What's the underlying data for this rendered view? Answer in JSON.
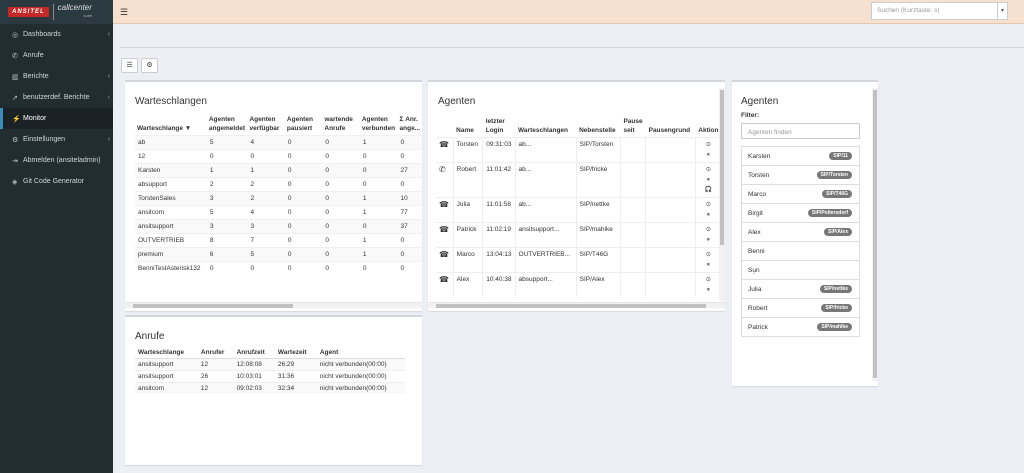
{
  "brand": {
    "logo_main": "ANSITEL",
    "logo_sub": "callcenter",
    "logo_suite": "suite"
  },
  "sidebar": {
    "items": [
      {
        "icon": "dashboard-icon",
        "glyph": "◎",
        "label": "Dashboards",
        "chevron": true
      },
      {
        "icon": "phone-icon",
        "glyph": "✆",
        "label": "Anrufe",
        "chevron": false
      },
      {
        "icon": "bar-chart-icon",
        "glyph": "▥",
        "label": "Berichte",
        "chevron": true
      },
      {
        "icon": "line-chart-icon",
        "glyph": "↗",
        "label": "benutzerdef. Berichte",
        "chevron": true
      },
      {
        "icon": "bolt-icon",
        "glyph": "⚡",
        "label": "Monitor",
        "chevron": false,
        "active": true
      },
      {
        "icon": "gears-icon",
        "glyph": "⚙",
        "label": "Einstellungen",
        "chevron": true
      },
      {
        "icon": "sign-out-icon",
        "glyph": "⇥",
        "label": "Abmelden (ansiteladmin)",
        "chevron": false
      },
      {
        "icon": "git-icon",
        "glyph": "◈",
        "label": "Git Code Generator",
        "chevron": false
      }
    ]
  },
  "header": {
    "search_placeholder": "Suchen (Kurztaste: s)"
  },
  "warteschlangen": {
    "title": "Warteschlangen",
    "columns": [
      "Warteschlange",
      "Agenten angemeldet",
      "Agenten verfügbar",
      "Agenten pausiert",
      "wartende Anrufe",
      "Agenten verbunden",
      "Σ Anr. ange..."
    ],
    "rows": [
      [
        "ab",
        "5",
        "4",
        "0",
        "0",
        "1",
        "0"
      ],
      [
        "12",
        "0",
        "0",
        "0",
        "0",
        "0",
        "0"
      ],
      [
        "Karsten",
        "1",
        "1",
        "0",
        "0",
        "0",
        "27"
      ],
      [
        "absupport",
        "2",
        "2",
        "0",
        "0",
        "0",
        "0"
      ],
      [
        "TorstenSales",
        "3",
        "2",
        "0",
        "0",
        "1",
        "10"
      ],
      [
        "ansitcom",
        "5",
        "4",
        "0",
        "0",
        "1",
        "77"
      ],
      [
        "ansitsupport",
        "3",
        "3",
        "0",
        "0",
        "0",
        "37"
      ],
      [
        "OUTVERTRIEB",
        "8",
        "7",
        "0",
        "0",
        "1",
        "0"
      ],
      [
        "premium",
        "6",
        "5",
        "0",
        "0",
        "1",
        "0"
      ],
      [
        "BenniTestAsterisk132",
        "0",
        "0",
        "0",
        "0",
        "0",
        "0"
      ]
    ]
  },
  "anrufe": {
    "title": "Anrufe",
    "columns": [
      "Warteschlange",
      "Anrufer",
      "Anrufzeit",
      "Wartezeit",
      "Agent"
    ],
    "rows": [
      [
        "ansitsupport",
        "12",
        "12:08:08",
        "26:29",
        "nicht verbunden(00:00)"
      ],
      [
        "ansitsupport",
        "26",
        "10:03:01",
        "31:36",
        "nicht verbunden(00:00)"
      ],
      [
        "ansitcom",
        "12",
        "09:02:03",
        "32:34",
        "nicht verbunden(00:00)"
      ]
    ]
  },
  "agenten_table": {
    "title": "Agenten",
    "columns": [
      "",
      "Name",
      "letzter Login",
      "Warteschlangen",
      "Nebenstelle",
      "Pause seit",
      "Pausengrund",
      "Aktion"
    ],
    "rows": [
      {
        "phone": "☎",
        "name": "Torsten",
        "login": "09:31:03",
        "queues": "ab...",
        "ext": "SIP/Torsten",
        "actions": [
          "⊙",
          "⏸"
        ]
      },
      {
        "phone": "✆",
        "name": "Robert",
        "login": "11:01:42",
        "queues": "ab...",
        "ext": "SIP/fricke",
        "actions": [
          "⊙",
          "⏸",
          "🎧"
        ]
      },
      {
        "phone": "☎",
        "name": "Julia",
        "login": "11:01:58",
        "queues": "ab...",
        "ext": "SIP/nettke",
        "actions": [
          "⊙",
          "⏸"
        ]
      },
      {
        "phone": "☎",
        "name": "Patrick",
        "login": "11:02:19",
        "queues": "ansitsupport...",
        "ext": "SIP/mahlke",
        "actions": [
          "⊙",
          "⏸"
        ]
      },
      {
        "phone": "☎",
        "name": "Marco",
        "login": "13:04:13",
        "queues": "OUTVERTRIEB...",
        "ext": "SIP/T46G",
        "actions": [
          "⊙",
          "⏸"
        ]
      },
      {
        "phone": "☎",
        "name": "Alex",
        "login": "10:40:38",
        "queues": "absupport...",
        "ext": "SIP/Alex",
        "actions": [
          "⊙",
          "⏸"
        ]
      }
    ]
  },
  "agenten_list": {
    "title": "Agenten",
    "filter_label": "Filter:",
    "filter_placeholder": "Agenten finden",
    "items": [
      {
        "name": "Karsten",
        "badge": "SIP/11"
      },
      {
        "name": "Torsten",
        "badge": "SIP/Torsten"
      },
      {
        "name": "Marco",
        "badge": "SIP/T46G"
      },
      {
        "name": "Birgit",
        "badge": "SIP/Poltersdorf"
      },
      {
        "name": "Alex",
        "badge": "SIP/Alex"
      },
      {
        "name": "Benni",
        "badge": ""
      },
      {
        "name": "Sṳn",
        "badge": ""
      },
      {
        "name": "Julia",
        "badge": "SIP/nettke"
      },
      {
        "name": "Robert",
        "badge": "SIP/fricke"
      },
      {
        "name": "Patrick",
        "badge": "SIP/mahlke"
      }
    ]
  }
}
